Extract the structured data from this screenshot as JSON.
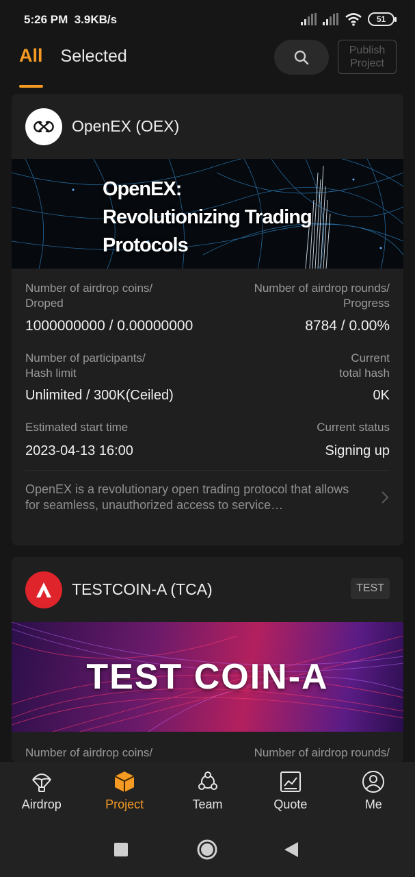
{
  "status_bar": {
    "time": "5:26 PM",
    "speed": "3.9KB/s",
    "battery": "51"
  },
  "header": {
    "tab_all": "All",
    "tab_selected": "Selected",
    "publish_line1": "Publish",
    "publish_line2": "Project"
  },
  "cards": [
    {
      "title": "OpenEX (OEX)",
      "banner_lines": [
        "OpenEX:",
        "Revolutionizing Trading",
        "Protocols"
      ],
      "coins_label_1": "Number of airdrop coins/",
      "coins_label_2": "Droped",
      "rounds_label_1": "Number of airdrop rounds/",
      "rounds_label_2": "Progress",
      "coins_value": "1000000000 / 0.00000000",
      "rounds_value": "8784 / 0.00%",
      "participants_label_1": "Number of participants/",
      "participants_label_2": "Hash limit",
      "hash_label_1": "Current",
      "hash_label_2": "total hash",
      "participants_value": "Unlimited / 300K(Ceiled)",
      "hash_value": "0K",
      "start_label": "Estimated start time",
      "status_label": "Current status",
      "start_value": "2023-04-13 16:00",
      "status_value": "Signing up",
      "description": "OpenEX is a revolutionary open trading protocol that allows for seamless, unauthorized access to service…"
    },
    {
      "title": "TESTCOIN-A (TCA)",
      "tag": "TEST",
      "banner_text": "TEST COIN-A",
      "coins_label_1": "Number of airdrop coins/",
      "rounds_label_1": "Number of airdrop rounds/"
    }
  ],
  "bottom_nav": [
    {
      "label": "Airdrop",
      "icon": "parachute-icon"
    },
    {
      "label": "Project",
      "icon": "cube-icon",
      "active": true
    },
    {
      "label": "Team",
      "icon": "team-icon"
    },
    {
      "label": "Quote",
      "icon": "chart-icon"
    },
    {
      "label": "Me",
      "icon": "user-icon"
    }
  ],
  "colors": {
    "accent": "#f59a23",
    "background": "#161616",
    "card": "#1f1f1f"
  }
}
